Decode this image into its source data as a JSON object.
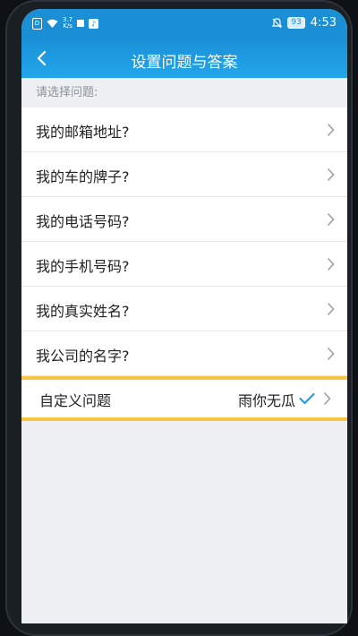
{
  "status_bar": {
    "speed_top": "3.7",
    "speed_bottom": "K/s",
    "battery": "93",
    "time": "4:53"
  },
  "nav": {
    "title": "设置问题与答案",
    "back_icon": "chevron-left-icon"
  },
  "section_header": "请选择问题:",
  "questions": [
    {
      "label": "我的邮箱地址?"
    },
    {
      "label": "我的车的牌子?"
    },
    {
      "label": "我的电话号码?"
    },
    {
      "label": "我的手机号码?"
    },
    {
      "label": "我的真实姓名?"
    },
    {
      "label": "我公司的名字?"
    }
  ],
  "custom_question": {
    "label": "自定义问题",
    "value": "雨你无瓜",
    "checked_icon": "check-icon"
  },
  "colors": {
    "accent": "#1a8fd6",
    "highlight": "#f6c543",
    "check": "#2a9be3"
  }
}
